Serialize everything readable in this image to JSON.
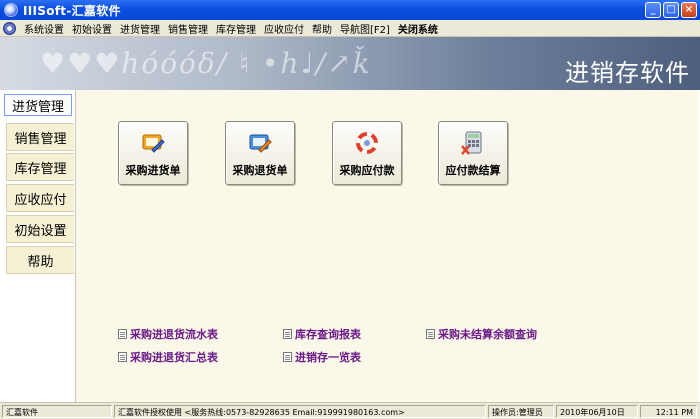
{
  "window": {
    "title": "IIISoft-汇嘉软件",
    "min": "_",
    "max": "□",
    "close": "×"
  },
  "menu": [
    "系统设置",
    "初始设置",
    "进货管理",
    "销售管理",
    "库存管理",
    "应收应付",
    "帮助",
    "导航图[F2]"
  ],
  "menu_exit": "关闭系统",
  "banner": {
    "title": "进销存软件",
    "decoration": "♥♥♥hóóóδ/ ♮ •h♩/↗ǩ"
  },
  "nav": {
    "active": "进货管理",
    "items": [
      "销售管理",
      "库存管理",
      "应收应付",
      "初始设置",
      "帮助"
    ]
  },
  "actions": [
    {
      "label": "采购进货单",
      "icon": "purchase-order-icon"
    },
    {
      "label": "采购退货单",
      "icon": "purchase-return-icon"
    },
    {
      "label": "采购应付款",
      "icon": "payable-icon"
    },
    {
      "label": "应付款结算",
      "icon": "calculator-icon"
    }
  ],
  "reports": [
    "采购进退货流水表",
    "库存查询报表",
    "采购未结算余额查询",
    "采购进退货汇总表",
    "进销存一览表"
  ],
  "status": {
    "company": "汇嘉软件",
    "license": "汇嘉软件授权使用",
    "hotline": "<服务热线:0573-82928635   Email:919991980163.com>",
    "operator": "操作员:管理员",
    "date": "2010年06月10日",
    "time": "12:11 PM"
  }
}
